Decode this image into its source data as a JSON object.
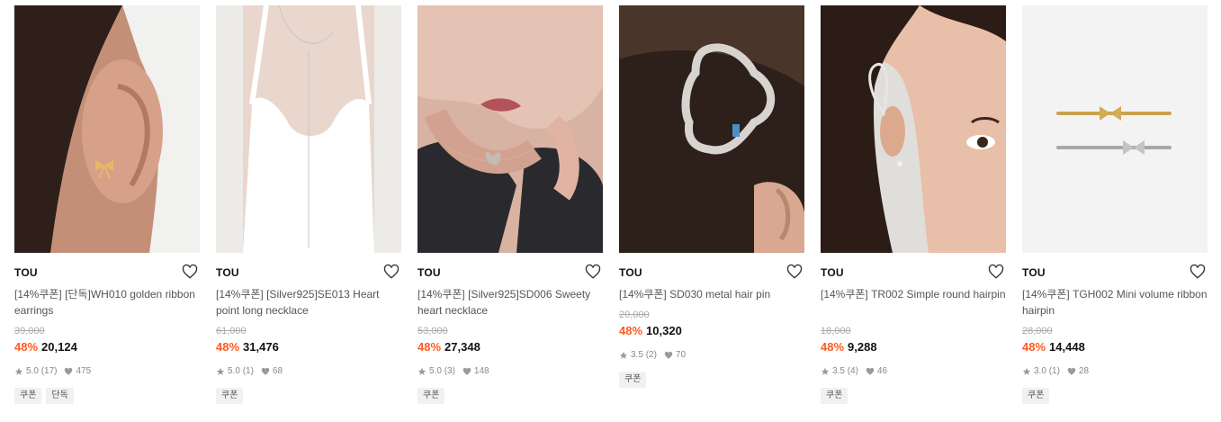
{
  "products": [
    {
      "brand": "TOU",
      "title": "[14%쿠폰] [단독]WH010 golden ribbon earrings",
      "original_price": "39,000",
      "discount_rate": "48%",
      "sale_price": "20,124",
      "rating": "5.0",
      "review_count": "(17)",
      "likes": "475",
      "badges": [
        "쿠폰",
        "단독"
      ],
      "thumb": "ear-ribbon-earring"
    },
    {
      "brand": "TOU",
      "title": "[14%쿠폰] [Silver925]SE013 Heart point long necklace",
      "original_price": "61,000",
      "discount_rate": "48%",
      "sale_price": "31,476",
      "rating": "5.0",
      "review_count": "(1)",
      "likes": "68",
      "badges": [
        "쿠폰"
      ],
      "thumb": "long-necklace-white-top"
    },
    {
      "brand": "TOU",
      "title": "[14%쿠폰] [Silver925]SD006 Sweety heart necklace",
      "original_price": "53,000",
      "discount_rate": "48%",
      "sale_price": "27,348",
      "rating": "5.0",
      "review_count": "(3)",
      "likes": "148",
      "badges": [
        "쿠폰"
      ],
      "thumb": "heart-necklace"
    },
    {
      "brand": "TOU",
      "title": "[14%쿠폰] SD030 metal hair pin",
      "original_price": "20,000",
      "discount_rate": "48%",
      "sale_price": "10,320",
      "rating": "3.5",
      "review_count": "(2)",
      "likes": "70",
      "badges": [
        "쿠폰"
      ],
      "thumb": "metal-hair-pin"
    },
    {
      "brand": "TOU",
      "title": "[14%쿠폰] TR002 Simple round hairpin",
      "original_price": "18,000",
      "discount_rate": "48%",
      "sale_price": "9,288",
      "rating": "3.5",
      "review_count": "(4)",
      "likes": "46",
      "badges": [
        "쿠폰"
      ],
      "thumb": "round-hairpin-model"
    },
    {
      "brand": "TOU",
      "title": "[14%쿠폰] TGH002 Mini volume ribbon hairpin",
      "original_price": "28,000",
      "discount_rate": "48%",
      "sale_price": "14,448",
      "rating": "3.0",
      "review_count": "(1)",
      "likes": "28",
      "badges": [
        "쿠폰"
      ],
      "thumb": "ribbon-hairpins-product"
    }
  ],
  "icons": {
    "wishlist": "heart-outline-icon",
    "rating": "star-icon",
    "likes": "heart-filled-icon"
  },
  "colors": {
    "discount": "#ff5a1f",
    "badge_bg": "#f1f1f1",
    "muted": "#888888"
  }
}
